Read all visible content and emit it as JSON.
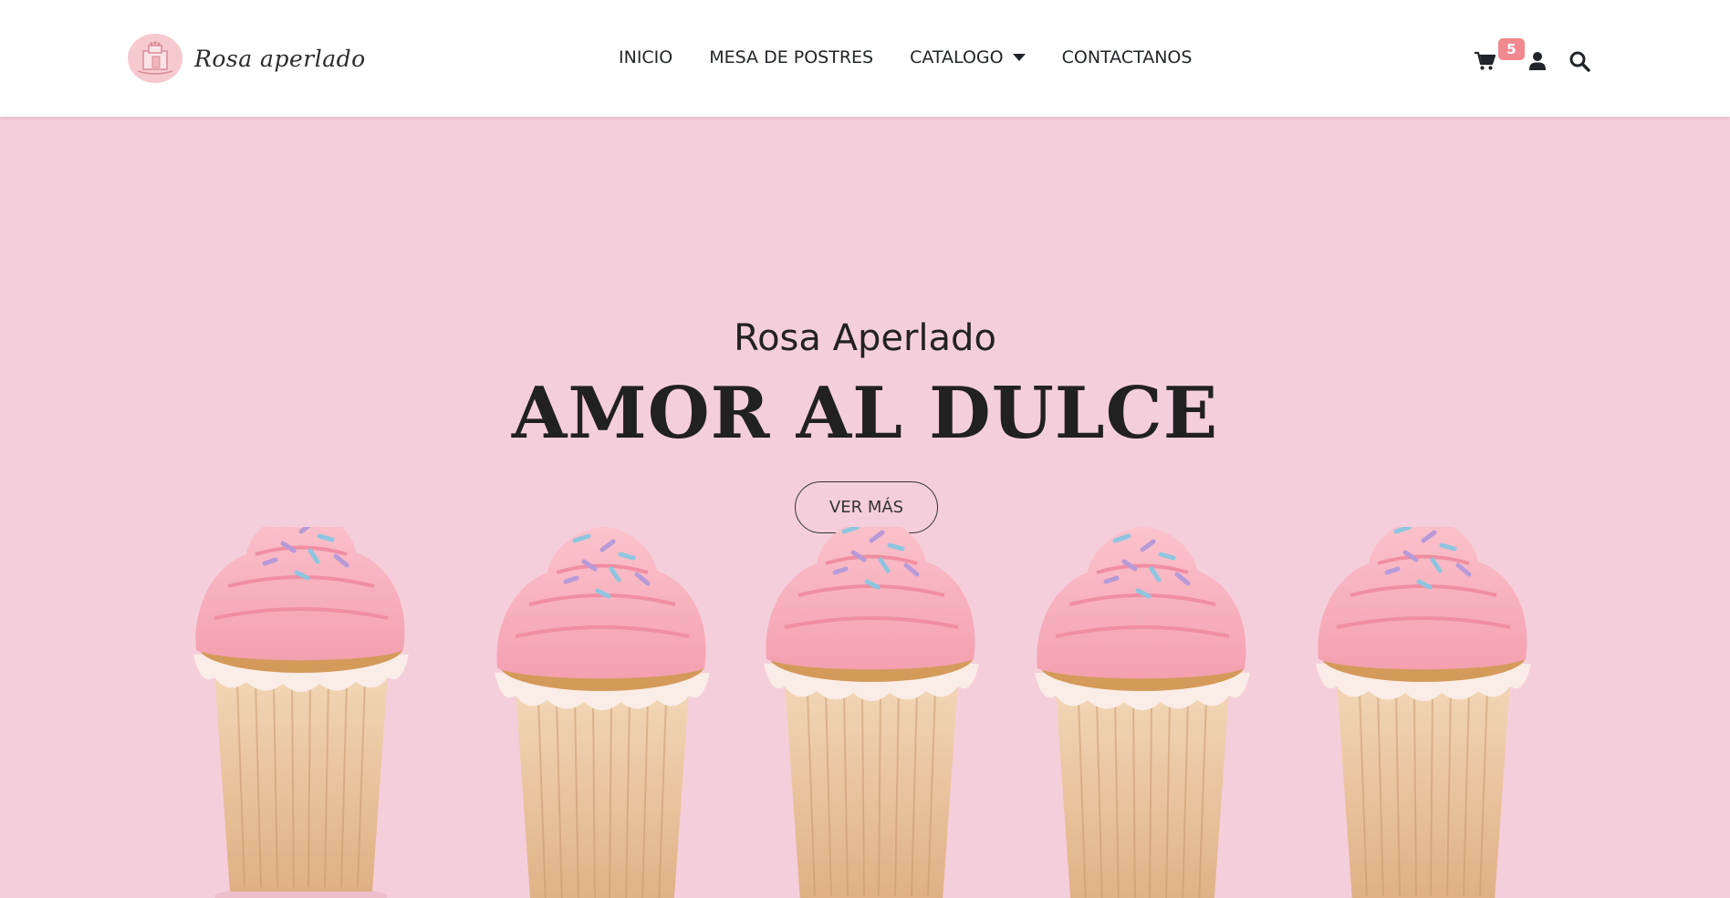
{
  "brand": {
    "name": "Rosa aperlado"
  },
  "nav": {
    "links": [
      {
        "label": "INICIO"
      },
      {
        "label": "MESA DE POSTRES"
      },
      {
        "label": "CATALOGO"
      },
      {
        "label": "CONTACTANOS"
      }
    ]
  },
  "header_icons": {
    "cart": {
      "icon": "shopping-cart-icon",
      "badge_count": "5"
    },
    "user": {
      "icon": "user-icon"
    },
    "search": {
      "icon": "search-icon"
    }
  },
  "hero": {
    "subtitle": "Rosa Aperlado",
    "title": "AMOR AL DULCE",
    "button_label": "VER MÁS"
  },
  "colors": {
    "hero_background": "#f5cedc",
    "badge": "#f0898f",
    "frosting": "#f7a9b8",
    "wrapper": "#e8c39a"
  }
}
